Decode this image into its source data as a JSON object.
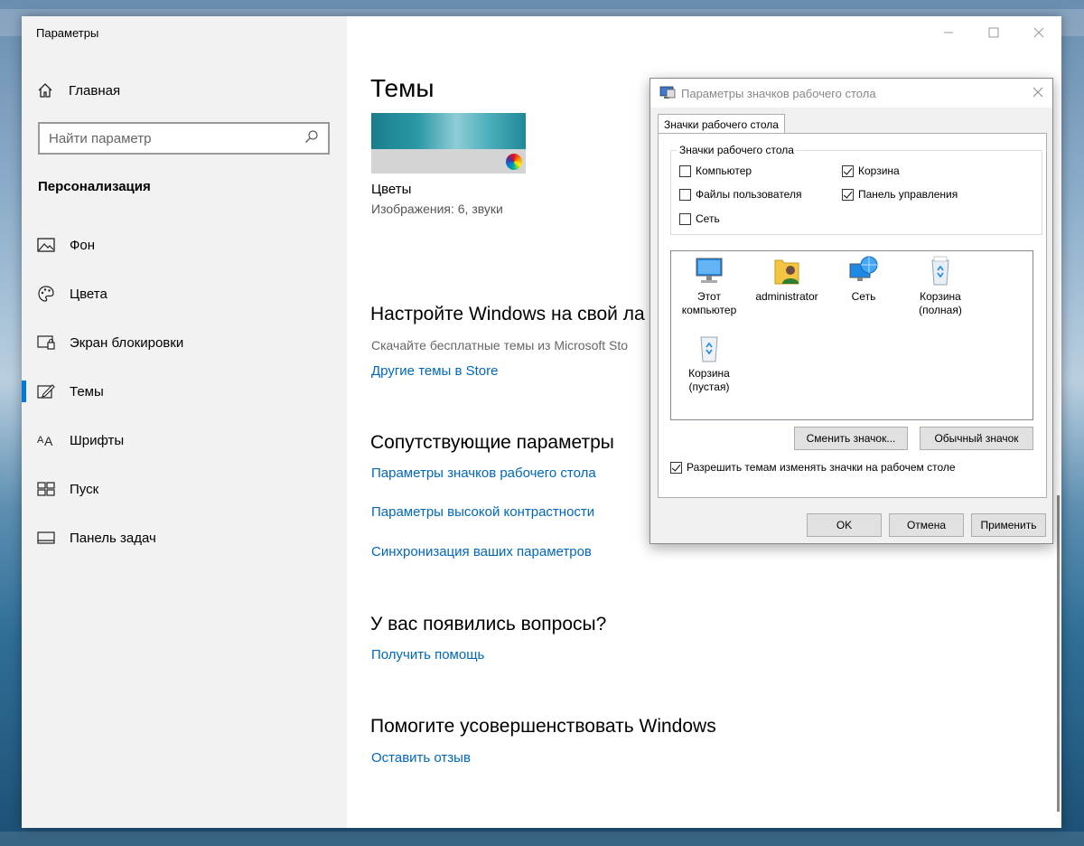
{
  "settings": {
    "app_title": "Параметры",
    "home_label": "Главная",
    "search_placeholder": "Найти параметр",
    "section_title": "Персонализация",
    "nav_items": [
      {
        "label": "Фон",
        "icon": "image-icon"
      },
      {
        "label": "Цвета",
        "icon": "palette-icon"
      },
      {
        "label": "Экран блокировки",
        "icon": "lock-screen-icon"
      },
      {
        "label": "Темы",
        "icon": "themes-icon",
        "active": true
      },
      {
        "label": "Шрифты",
        "icon": "fonts-icon"
      },
      {
        "label": "Пуск",
        "icon": "start-icon"
      },
      {
        "label": "Панель задач",
        "icon": "taskbar-icon"
      }
    ],
    "accent_color": "#0078d7"
  },
  "content": {
    "page_title": "Темы",
    "theme": {
      "name": "Цветы",
      "description": "Изображения: 6, звуки"
    },
    "customize": {
      "heading": "Настройте Windows на свой ла",
      "description": "Скачайте бесплатные темы из Microsoft Sto",
      "link": "Другие темы в Store"
    },
    "related": {
      "heading": "Сопутствующие параметры",
      "links": [
        "Параметры значков рабочего стола",
        "Параметры высокой контрастности",
        "Синхронизация ваших параметров"
      ]
    },
    "questions": {
      "heading": "У вас появились вопросы?",
      "link": "Получить помощь"
    },
    "improve": {
      "heading": "Помогите усовершенствовать Windows",
      "link": "Оставить отзыв"
    },
    "link_color": "#0067c0"
  },
  "dialog": {
    "title": "Параметры значков рабочего стола",
    "tab": "Значки рабочего стола",
    "group_label": "Значки рабочего стола",
    "checkboxes": [
      {
        "label": "Компьютер",
        "checked": false
      },
      {
        "label": "Корзина",
        "checked": true
      },
      {
        "label": "Файлы пользователя",
        "checked": false
      },
      {
        "label": "Панель управления",
        "checked": true
      },
      {
        "label": "Сеть",
        "checked": false
      }
    ],
    "icons": [
      {
        "label": "Этот компьютер",
        "icon": "computer-icon"
      },
      {
        "label": "administrator",
        "icon": "user-folder-icon"
      },
      {
        "label": "Сеть",
        "icon": "network-icon"
      },
      {
        "label": "Корзина (полная)",
        "icon": "recycle-bin-full-icon"
      },
      {
        "label": "Корзина (пустая)",
        "icon": "recycle-bin-empty-icon"
      }
    ],
    "change_icon_button": "Сменить значок...",
    "default_icon_button": "Обычный значок",
    "allow_themes_checkbox": {
      "label": "Разрешить темам изменять значки на рабочем столе",
      "checked": true
    },
    "ok_button": "OK",
    "cancel_button": "Отмена",
    "apply_button": "Применить"
  }
}
